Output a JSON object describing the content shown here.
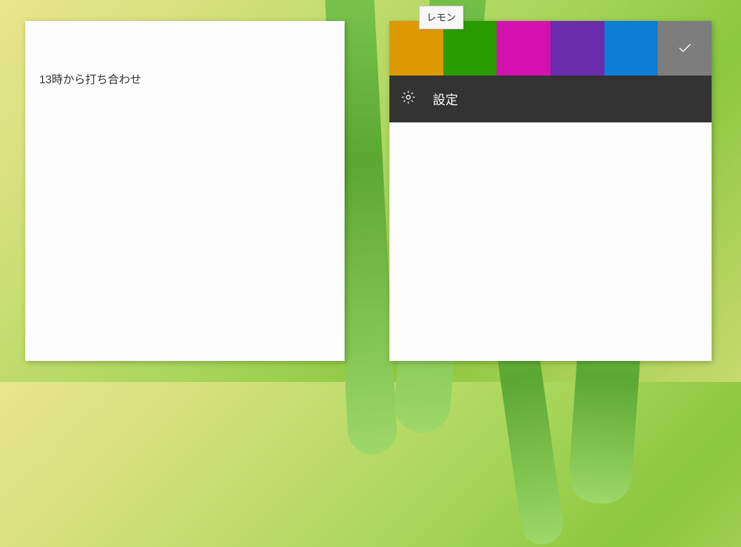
{
  "note1": {
    "content": "13時から打ち合わせ"
  },
  "note2": {
    "tooltip": "レモン",
    "colors": [
      {
        "name": "orange",
        "hex": "#dd9900",
        "selected": false
      },
      {
        "name": "green",
        "hex": "#279b00",
        "selected": false
      },
      {
        "name": "magenta",
        "hex": "#d510b0",
        "selected": false
      },
      {
        "name": "purple",
        "hex": "#6b2cab",
        "selected": false
      },
      {
        "name": "blue",
        "hex": "#0d7dd6",
        "selected": false
      },
      {
        "name": "gray",
        "hex": "#7d7d7d",
        "selected": true
      }
    ],
    "settings_label": "設定"
  }
}
